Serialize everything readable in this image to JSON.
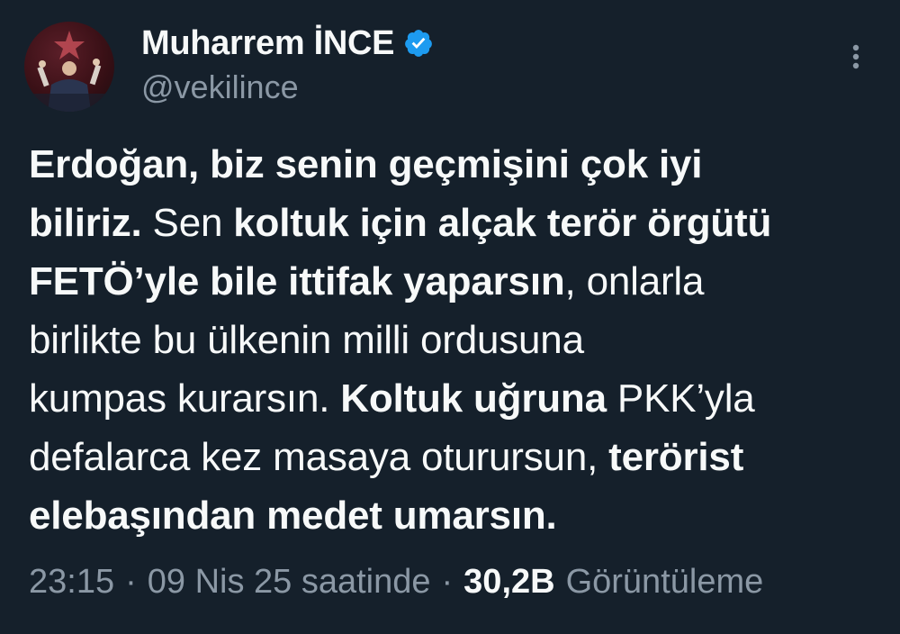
{
  "author": {
    "display_name": "Muharrem İNCE",
    "handle": "@vekilince",
    "verified": true,
    "avatar_icon": "profile-photo"
  },
  "colors": {
    "background": "#15202b",
    "text": "#f7f9f9",
    "muted": "#8b98a5",
    "verified_badge": "#1d9bf0"
  },
  "more_icon": "more-options-icon",
  "tweet_lines": [
    [
      {
        "text": "Erdoğan, biz senin geçmişini çok iyi",
        "bold": true
      }
    ],
    [
      {
        "text": "biliriz.",
        "bold": true
      },
      {
        "text": " Sen ",
        "bold": false
      },
      {
        "text": "koltuk için alçak terör örgütü",
        "bold": true
      }
    ],
    [
      {
        "text": "FETÖ’yle bile ittifak yaparsın",
        "bold": true
      },
      {
        "text": ", onlarla",
        "bold": false
      }
    ],
    [
      {
        "text": "birlikte bu ülkenin milli ordusuna",
        "bold": false
      }
    ],
    [
      {
        "text": "kumpas kurarsın. ",
        "bold": false
      },
      {
        "text": "Koltuk uğruna",
        "bold": true
      },
      {
        "text": " PKK’yla",
        "bold": false
      }
    ],
    [
      {
        "text": "defalarca kez masaya oturursun, ",
        "bold": false
      },
      {
        "text": "terörist",
        "bold": true
      }
    ],
    [
      {
        "text": "elebaşından medet umarsın.",
        "bold": true
      }
    ]
  ],
  "meta": {
    "time": "23:15",
    "separator": "·",
    "date": "09 Nis 25 saatinde",
    "views_count": "30,2B",
    "views_label": "Görüntüleme"
  }
}
